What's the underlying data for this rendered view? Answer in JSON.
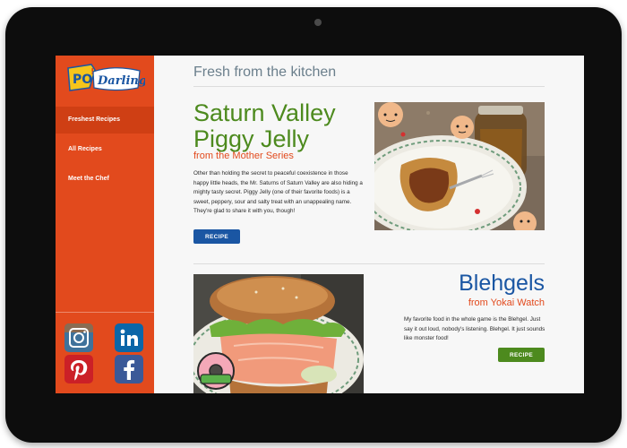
{
  "brand": {
    "logo_text": "Pop! Darling"
  },
  "sidebar": {
    "items": [
      {
        "label": "Freshest Recipes"
      },
      {
        "label": "All Recipes"
      },
      {
        "label": "Meet the Chef"
      }
    ],
    "social": [
      "instagram-icon",
      "linkedin-icon",
      "pinterest-icon",
      "facebook-icon"
    ]
  },
  "main": {
    "title": "Fresh from the kitchen",
    "recipes": [
      {
        "title": "Saturn Valley Piggy Jelly",
        "subtitle": "from the Mother Series",
        "description": "Other than holding the secret to peaceful coexistence in those happy little heads, the Mr. Saturns of Saturn Valley are also hiding a mighty tasty secret. Piggy Jelly (one of their favorite foods) is a sweet, peppery, sour and salty treat with an unappealing name. They're glad to share it with you, though!",
        "button": "RECIPE"
      },
      {
        "title": "Blehgels",
        "subtitle": "from Yokai Watch",
        "description": "My favorite food in the whole game is the Blehgel. Just say it out loud, nobody's listening. Blehgel. It just sounds like monster food!",
        "button": "RECIPE"
      }
    ]
  },
  "colors": {
    "sidebar": "#e24a1d",
    "green": "#4d8a1e",
    "blue": "#1a56a3",
    "frame": "#0d0d0d"
  }
}
